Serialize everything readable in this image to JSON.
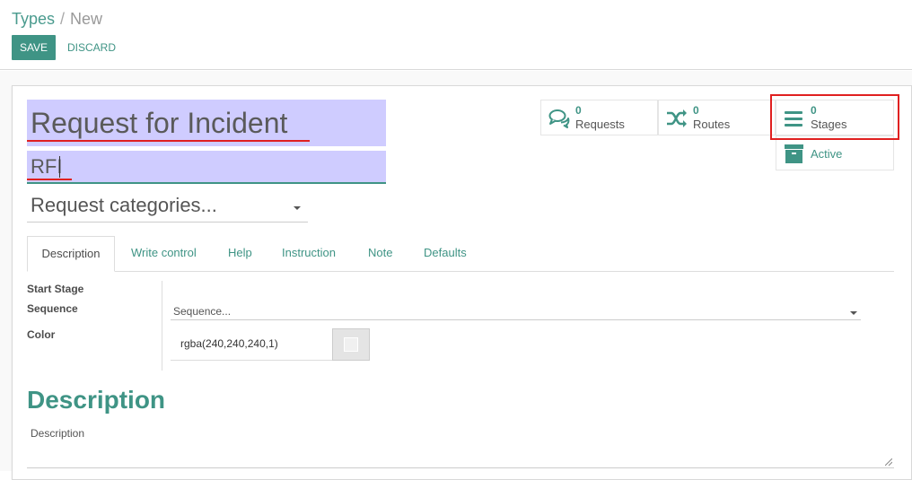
{
  "breadcrumb": {
    "parent": "Types",
    "separator": "/",
    "current": "New"
  },
  "toolbar": {
    "save_label": "SAVE",
    "discard_label": "DISCARD"
  },
  "form": {
    "name_value": "Request for Incident",
    "code_value": "RFI",
    "categories_placeholder": "Request categories..."
  },
  "stat_buttons": {
    "requests": {
      "count": "0",
      "label": "Requests",
      "icon": "comments-icon"
    },
    "routes": {
      "count": "0",
      "label": "Routes",
      "icon": "random-icon"
    },
    "stages": {
      "count": "0",
      "label": "Stages",
      "icon": "bars-icon"
    },
    "active": {
      "label": "Active",
      "icon": "archive-icon"
    }
  },
  "tabs": [
    "Description",
    "Write control",
    "Help",
    "Instruction",
    "Note",
    "Defaults"
  ],
  "fields": {
    "start_stage_label": "Start Stage",
    "sequence_label": "Sequence",
    "sequence_placeholder": "Sequence...",
    "color_label": "Color",
    "color_value": "rgba(240,240,240,1)"
  },
  "description": {
    "heading": "Description",
    "placeholder": "Description"
  },
  "colors": {
    "accent": "#3f9485",
    "highlight": "#e02020",
    "selection": "#cfccff"
  }
}
